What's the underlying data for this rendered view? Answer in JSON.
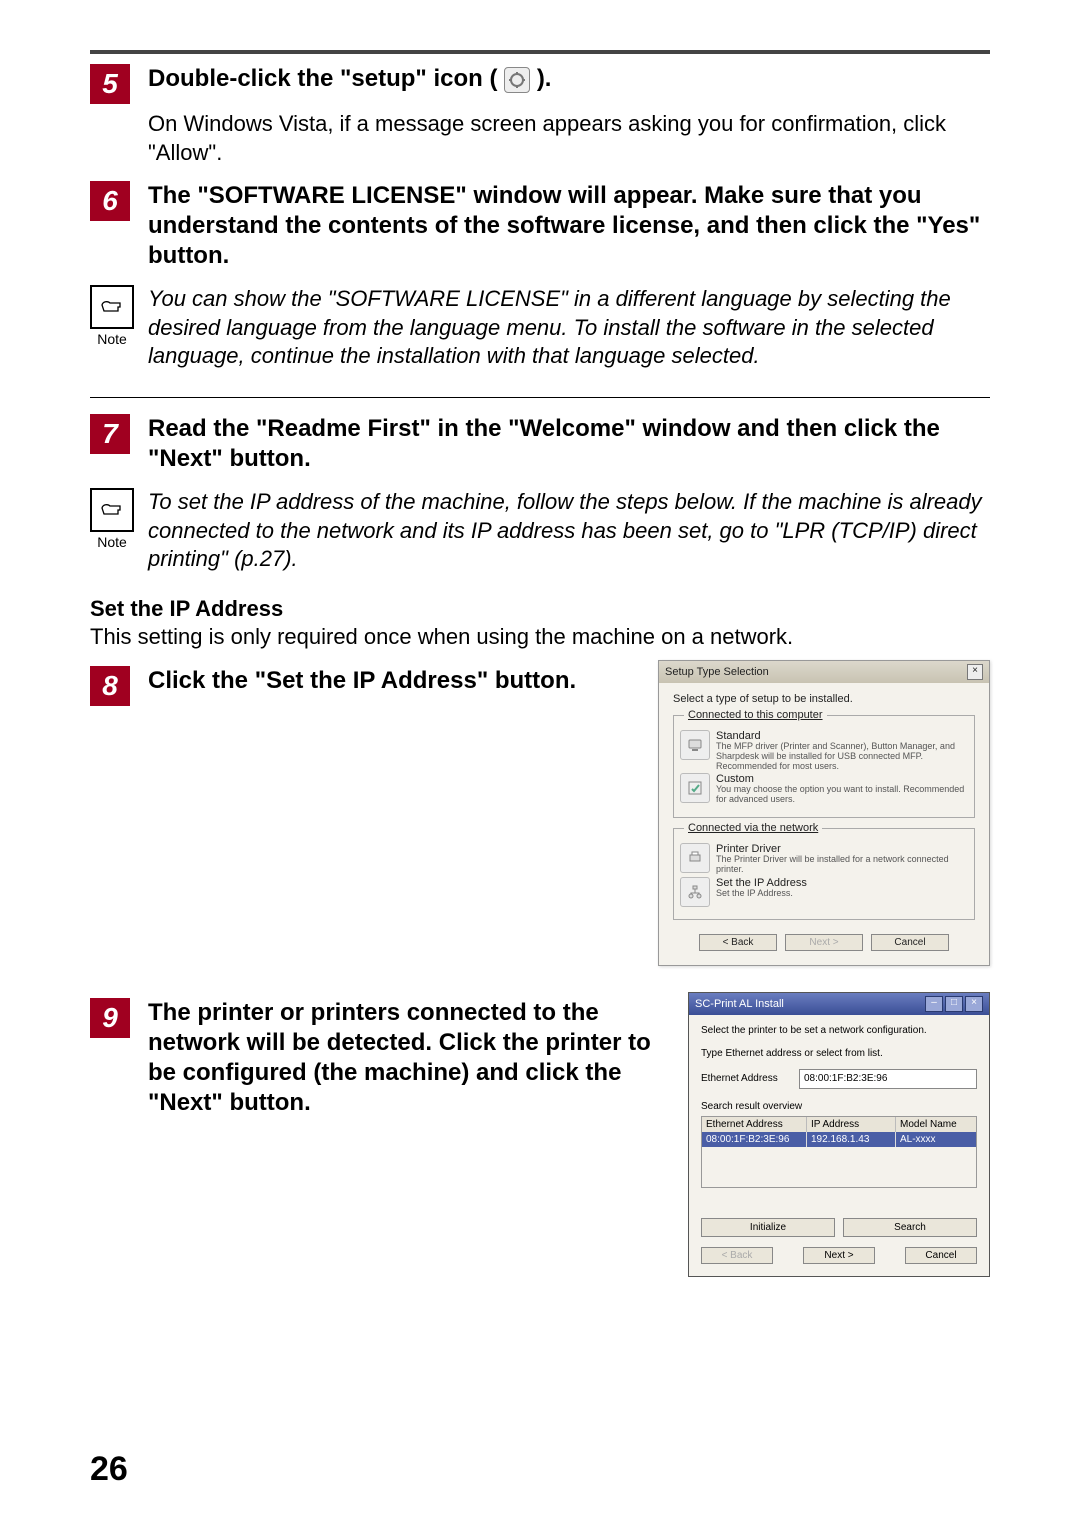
{
  "page_number": "26",
  "steps": {
    "s5": {
      "num": "5",
      "head_a": "Double-click the \"setup\" icon (",
      "head_b": ").",
      "body": "On Windows Vista, if a message screen appears asking you for confirmation, click \"Allow\"."
    },
    "s6": {
      "num": "6",
      "head": "The \"SOFTWARE LICENSE\" window will appear. Make sure that you understand the contents of the software license, and then click the \"Yes\" button."
    },
    "s7": {
      "num": "7",
      "head": "Read the \"Readme First\" in the \"Welcome\" window and then click the \"Next\" button."
    },
    "s8": {
      "num": "8",
      "head": "Click the \"Set the IP Address\" button."
    },
    "s9": {
      "num": "9",
      "head": "The printer or printers connected to the network will be detected. Click the printer to be configured (the machine) and click the \"Next\" button."
    }
  },
  "notes": {
    "label": "Note",
    "n1": "You can show the \"SOFTWARE LICENSE\" in a different language by selecting the desired language from the language menu. To install the software in the selected language, continue the installation with that language selected.",
    "n2": "To set the IP address of the machine, follow the steps below. If the machine is already connected to the network and its IP address has been set, go to \"LPR (TCP/IP) direct printing\" (p.27)."
  },
  "subsection": {
    "head": "Set the IP Address",
    "body": "This setting is only required once when using the machine on a network."
  },
  "dialog1": {
    "title": "Setup Type Selection",
    "prompt": "Select a type of setup to be installed.",
    "group1_legend": "Connected to this computer",
    "opt_std_title": "Standard",
    "opt_std_desc": "The MFP driver (Printer and Scanner), Button Manager, and Sharpdesk will be installed for USB connected MFP.  Recommended for most users.",
    "opt_cus_title": "Custom",
    "opt_cus_desc": "You may choose the option you want to install. Recommended for advanced users.",
    "group2_legend": "Connected via the network",
    "opt_prn_title": "Printer Driver",
    "opt_prn_desc": "The Printer Driver will be installed for a network connected printer.",
    "opt_ip_title": "Set the IP Address",
    "opt_ip_desc": "Set the IP Address.",
    "btn_back": "< Back",
    "btn_next": "Next >",
    "btn_cancel": "Cancel"
  },
  "dialog2": {
    "title": "SC-Print AL Install",
    "prompt": "Select the printer to be set a network configuration.",
    "hint": "Type Ethernet address or select from list.",
    "eth_label": "Ethernet Address",
    "eth_value": "08:00:1F:B2:3E:96",
    "search_label": "Search result overview",
    "col_eth": "Ethernet Address",
    "col_ip": "IP Address",
    "col_model": "Model Name",
    "row_eth": "08:00:1F:B2:3E:96",
    "row_ip": "192.168.1.43",
    "row_model": "AL-xxxx",
    "btn_init": "Initialize",
    "btn_search": "Search",
    "btn_back": "< Back",
    "btn_next": "Next >",
    "btn_cancel": "Cancel"
  }
}
